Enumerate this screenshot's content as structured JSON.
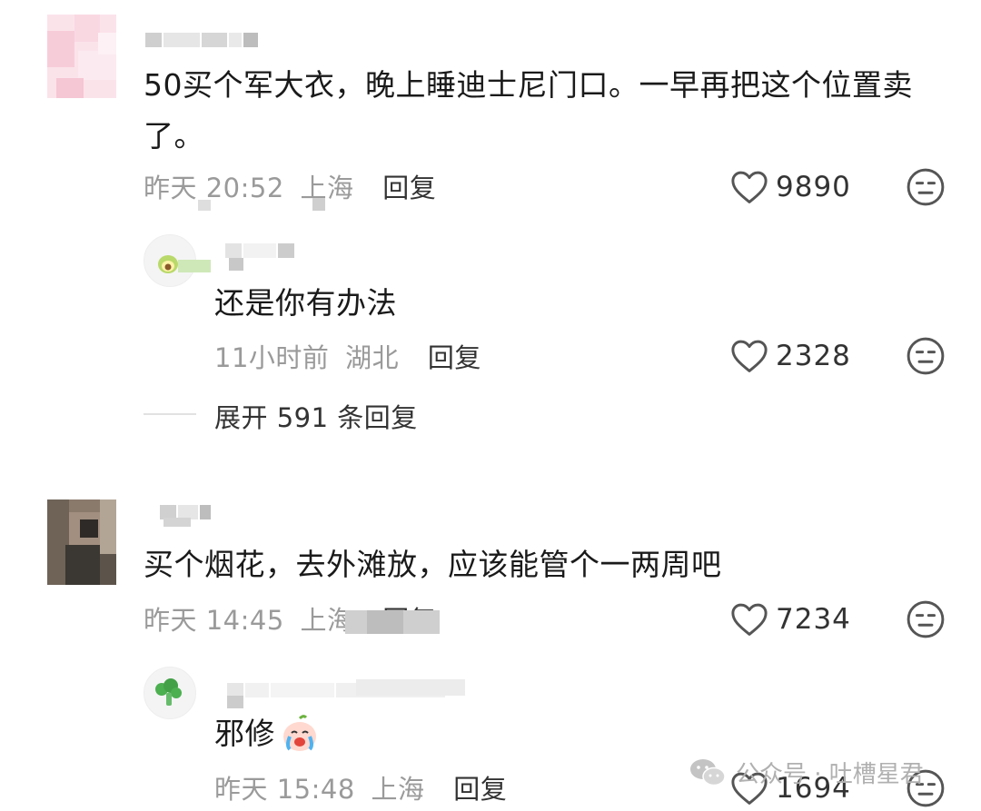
{
  "comments": [
    {
      "text": "50买个军大衣，晚上睡迪士尼门口。一早再把这个位置卖了。",
      "time": "昨天 20:52",
      "location": "上海",
      "reply_label": "回复",
      "likes": "9890",
      "replies": [
        {
          "text": "还是你有办法",
          "time": "11小时前",
          "location": "湖北",
          "reply_label": "回复",
          "likes": "2328"
        }
      ],
      "expand_label": "展开 591 条回复"
    },
    {
      "text": "买个烟花，去外滩放，应该能管个一两周吧",
      "time": "昨天 14:45",
      "location": "上海",
      "reply_label": "回复",
      "likes": "7234",
      "replies": [
        {
          "text": "邪修",
          "time": "昨天 15:48",
          "location": "上海",
          "reply_label": "回复",
          "likes": "1694"
        }
      ]
    }
  ],
  "watermark": {
    "text": "公众号 · 吐槽星君",
    "icon": "wechat-icon"
  },
  "colors": {
    "meta": "#9a9a9a",
    "text": "#1a1a1a",
    "icon": "#555555"
  }
}
